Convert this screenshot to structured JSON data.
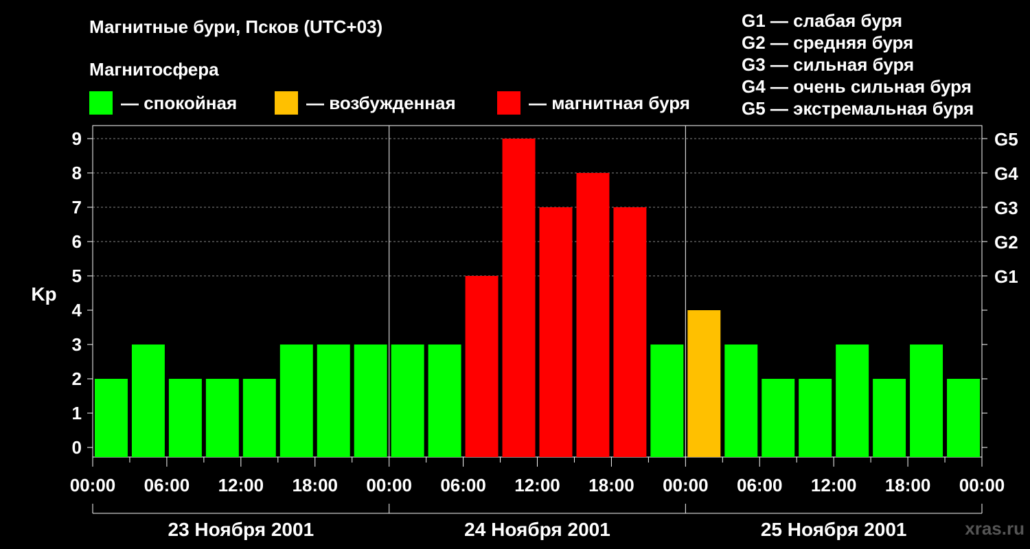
{
  "title": "Магнитные бури, Псков (UTC+03)",
  "magnetosphere_title": "Магнитосфера",
  "legend": [
    {
      "label": "— спокойная",
      "color": "#00ff00"
    },
    {
      "label": "— возбужденная",
      "color": "#ffc000"
    },
    {
      "label": "— магнитная буря",
      "color": "#ff0000"
    }
  ],
  "g_legend": [
    "G1 — слабая буря",
    "G2 — средняя буря",
    "G3 — сильная буря",
    "G4 — очень сильная буря",
    "G5 — экстремальная буря"
  ],
  "watermark": "xras.ru",
  "chart_data": {
    "type": "bar",
    "ylabel": "Kp",
    "ylim": [
      0,
      9
    ],
    "y_ticks": [
      "0",
      "1",
      "2",
      "3",
      "4",
      "5",
      "6",
      "7",
      "8",
      "9"
    ],
    "right_axis_labels": [
      {
        "value": 5,
        "label": "G1"
      },
      {
        "value": 6,
        "label": "G2"
      },
      {
        "value": 7,
        "label": "G3"
      },
      {
        "value": 8,
        "label": "G4"
      },
      {
        "value": 9,
        "label": "G5"
      }
    ],
    "x_tick_labels": [
      "00:00",
      "06:00",
      "12:00",
      "18:00",
      "00:00",
      "06:00",
      "12:00",
      "18:00",
      "00:00",
      "06:00",
      "12:00",
      "18:00",
      "00:00"
    ],
    "days": [
      "23 Ноября 2001",
      "24 Ноября 2001",
      "25 Ноября 2001"
    ],
    "interval_hours": 3,
    "values": [
      2,
      3,
      2,
      2,
      2,
      3,
      3,
      3,
      3,
      3,
      5,
      9,
      7,
      8,
      7,
      3,
      4,
      3,
      2,
      2,
      3,
      2,
      3,
      2
    ],
    "colors": {
      "quiet": "#00ff00",
      "active": "#ffc000",
      "storm": "#ff0000"
    },
    "grid": "dashed horizontal lines at G levels"
  }
}
